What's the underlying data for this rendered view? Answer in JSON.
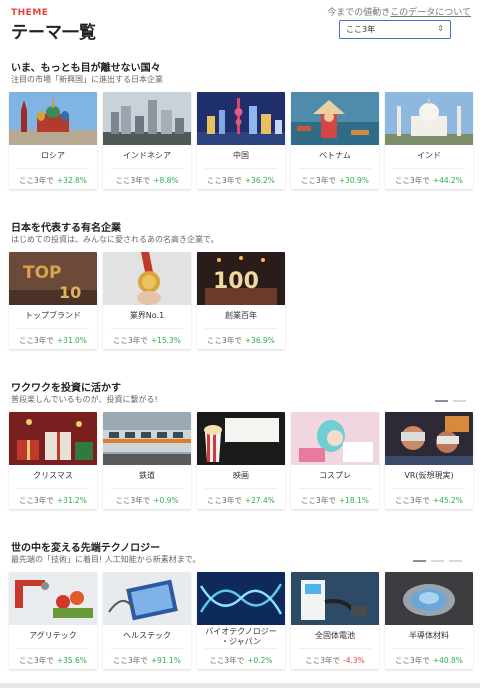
{
  "header": {
    "theme_label": "THEME",
    "title": "テーマ一覧",
    "link_prefix": "今までの値動き",
    "link_text": "このデータについて",
    "period_select": "ここ3年"
  },
  "colors": {
    "accent": "#e8423f",
    "positive": "#2cb04a",
    "negative": "#e8423f",
    "select_border": "#3e73c8"
  },
  "sections": [
    {
      "title": "いま、もっとも目が離せない国々",
      "subtitle": "注目の市場「新興国」に進出する日本企業",
      "cards": [
        {
          "name": "ロシア",
          "period": "ここ3年で",
          "pct": "+32.8%",
          "icon": "moscow-photo"
        },
        {
          "name": "インドネシア",
          "period": "ここ3年で",
          "pct": "+8.8%",
          "icon": "jakarta-photo"
        },
        {
          "name": "中国",
          "period": "ここ3年で",
          "pct": "+36.2%",
          "icon": "shanghai-photo"
        },
        {
          "name": "ベトナム",
          "period": "ここ3年で",
          "pct": "+30.9%",
          "icon": "vietnam-photo"
        },
        {
          "name": "インド",
          "period": "ここ3年で",
          "pct": "+44.2%",
          "icon": "taj-mahal-photo"
        }
      ]
    },
    {
      "title": "日本を代表する有名企業",
      "subtitle": "はじめての投資は、みんなに愛されるあの名高き企業で。",
      "cards": [
        {
          "name": "トップブランド",
          "period": "ここ3年で",
          "pct": "+31.0%",
          "icon": "top10-photo"
        },
        {
          "name": "業界No.1",
          "period": "ここ3年で",
          "pct": "+15.3%",
          "icon": "medal-photo"
        },
        {
          "name": "創業百年",
          "period": "ここ3年で",
          "pct": "+36.9%",
          "icon": "cake-100-photo"
        }
      ]
    },
    {
      "title": "ワクワクを投資に活かす",
      "subtitle": "普段楽しんでいるものが、投資に繋がる!",
      "cards": [
        {
          "name": "クリスマス",
          "period": "ここ3年で",
          "pct": "+31.2%",
          "icon": "christmas-photo"
        },
        {
          "name": "鉄道",
          "period": "ここ3年で",
          "pct": "+0.9%",
          "icon": "train-photo"
        },
        {
          "name": "映画",
          "period": "ここ3年で",
          "pct": "+27.4%",
          "icon": "cinema-photo"
        },
        {
          "name": "コスプレ",
          "period": "ここ3年で",
          "pct": "+18.1%",
          "icon": "cosplay-photo"
        },
        {
          "name": "VR(仮想現実)",
          "period": "ここ3年で",
          "pct": "+45.2%",
          "icon": "vr-photo"
        }
      ]
    },
    {
      "title": "世の中を変える先端テクノロジー",
      "subtitle": "最先端の「技術」に着目! 人工知能から新素材まで。",
      "cards": [
        {
          "name": "アグリテック",
          "period": "ここ3年で",
          "pct": "+35.6%",
          "icon": "agritech-photo"
        },
        {
          "name": "ヘルステック",
          "period": "ここ3年で",
          "pct": "+91.1%",
          "icon": "healthtech-photo"
        },
        {
          "name": "バイオテクノロジー・ジャパン",
          "name_l1": "バイオテクノロジー",
          "name_l2": "・ジャパン",
          "period": "ここ3年で",
          "pct": "+0.2%",
          "icon": "dna-photo"
        },
        {
          "name": "全固体電池",
          "period": "ここ3年で",
          "pct": "-4.3%",
          "icon": "battery-photo"
        },
        {
          "name": "半導体材料",
          "period": "ここ3年で",
          "pct": "+40.8%",
          "icon": "wafer-photo"
        }
      ]
    }
  ]
}
